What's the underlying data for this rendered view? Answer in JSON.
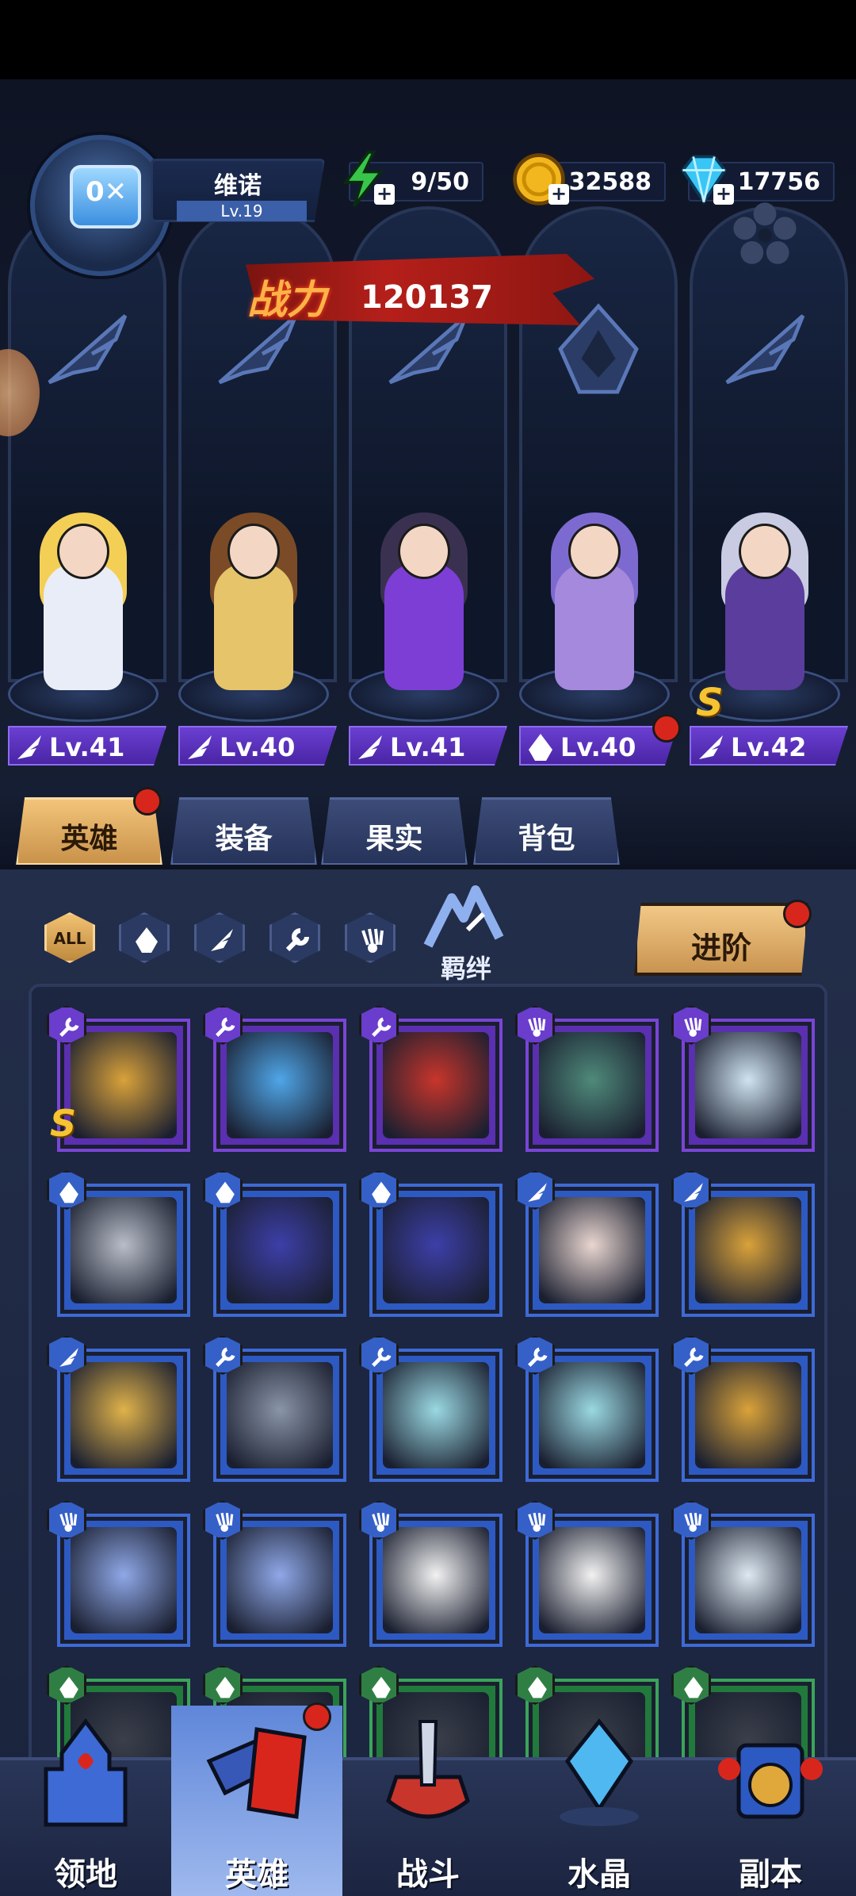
{
  "player": {
    "name": "维诺",
    "level": "Lv.19"
  },
  "resources": [
    {
      "name": "energy",
      "value": "9/50",
      "color": "#37c64a"
    },
    {
      "name": "gold",
      "value": "32588",
      "color": "#f2b61e"
    },
    {
      "name": "diamond",
      "value": "17756",
      "color": "#38c6f5"
    }
  ],
  "power": {
    "label": "战力",
    "value": "120137"
  },
  "lineup": [
    {
      "level": "Lv.41",
      "class": "wing",
      "hair": "#f3cf56",
      "outfit": "#e9edf7"
    },
    {
      "level": "Lv.40",
      "class": "wing",
      "hair": "#7a4b26",
      "outfit": "#e6c46a"
    },
    {
      "level": "Lv.41",
      "class": "wing",
      "hair": "#3a3150",
      "outfit": "#7d3ed6"
    },
    {
      "level": "Lv.40",
      "class": "hood",
      "hair": "#7d6ad0",
      "outfit": "#a489dd"
    },
    {
      "level": "Lv.42",
      "class": "wing",
      "hair": "#c9cbe2",
      "outfit": "#5a3d9c",
      "rank": "S"
    }
  ],
  "tabs": [
    "英雄",
    "装备",
    "果实",
    "背包"
  ],
  "filters": {
    "all": "ALL",
    "bond": "羁绊"
  },
  "advance_label": "进阶",
  "roster": [
    {
      "class": "wrench",
      "frame": "purple",
      "art": "#d9a23a",
      "rank": "S"
    },
    {
      "class": "wrench",
      "frame": "purple",
      "art": "#4fa6e8"
    },
    {
      "class": "wrench",
      "frame": "purple",
      "art": "#c8352b"
    },
    {
      "class": "claw",
      "frame": "purple",
      "art": "#4f8a7a"
    },
    {
      "class": "claw",
      "frame": "purple",
      "art": "#cfe3ef"
    },
    {
      "class": "hood",
      "frame": "blue",
      "art": "#b8bdc8"
    },
    {
      "class": "hood",
      "frame": "blue",
      "art": "#3d3fa8"
    },
    {
      "class": "hood",
      "frame": "blue",
      "art": "#3d3fa8"
    },
    {
      "class": "wing",
      "frame": "blue",
      "art": "#e9d6d0"
    },
    {
      "class": "wing",
      "frame": "blue",
      "art": "#d9a23a"
    },
    {
      "class": "wing",
      "frame": "blue",
      "art": "#e0b24a"
    },
    {
      "class": "wrench",
      "frame": "blue",
      "art": "#8a95a8"
    },
    {
      "class": "wrench",
      "frame": "blue",
      "art": "#9ad9e2"
    },
    {
      "class": "wrench",
      "frame": "blue",
      "art": "#9ad9e2"
    },
    {
      "class": "wrench",
      "frame": "blue",
      "art": "#d9a23a"
    },
    {
      "class": "claw",
      "frame": "blue",
      "art": "#8fa8e8"
    },
    {
      "class": "claw",
      "frame": "blue",
      "art": "#8fa8e8"
    },
    {
      "class": "claw",
      "frame": "blue",
      "art": "#f2f2f2"
    },
    {
      "class": "claw",
      "frame": "blue",
      "art": "#f2f2f2"
    },
    {
      "class": "claw",
      "frame": "blue",
      "art": "#dde9f2"
    },
    {
      "class": "hood",
      "frame": "green",
      "art": "#3a3f4a"
    },
    {
      "class": "hood",
      "frame": "green",
      "art": "#3a3f4a"
    },
    {
      "class": "hood",
      "frame": "green",
      "art": "#3a3f4a"
    },
    {
      "class": "hood",
      "frame": "green",
      "art": "#3a3f4a"
    },
    {
      "class": "hood",
      "frame": "green",
      "art": "#3a3f4a"
    }
  ],
  "nav": [
    "领地",
    "英雄",
    "战斗",
    "水晶",
    "副本"
  ]
}
